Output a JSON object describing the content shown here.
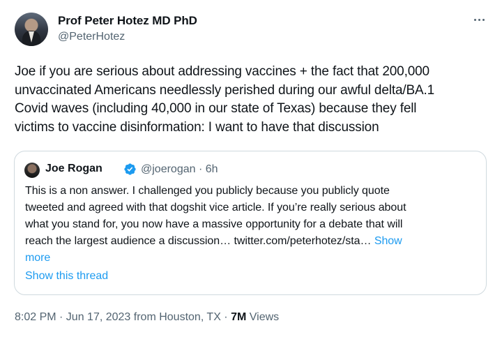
{
  "author": {
    "name": "Prof Peter Hotez MD PhD",
    "handle": "@PeterHotez"
  },
  "tweet": {
    "lines": [
      "Joe if you are serious about addressing vaccines + the fact that 200,000",
      "unvaccinated Americans needlessly perished during our awful delta/BA.1",
      "Covid waves (including 40,000 in our state of Texas) because they fell",
      "victims to vaccine disinformation: I want to have that discussion"
    ]
  },
  "quote": {
    "name": "Joe Rogan",
    "handle_time": "@joerogan · 6h",
    "lines": [
      "This is a non answer.  I challenged you publicly because you publicly quote",
      "tweeted and agreed with that dogshit vice article.  If you’re really serious about",
      "what you stand for, you now have a massive opportunity for a debate that will",
      "reach the largest audience a discussion… twitter.com/peterhotez/sta…"
    ],
    "show_more_1": "Show",
    "show_more_2": "more",
    "show_thread": "Show this thread"
  },
  "meta": {
    "time_date_location": "8:02 PM · Jun 17, 2023 from Houston, TX · ",
    "views_count": "7M",
    "views_label": " Views"
  },
  "icons": {
    "more": "more-horizontal-icon",
    "verified": "verified-badge-icon"
  },
  "colors": {
    "link": "#1d9bf0",
    "secondary_text": "#536471",
    "primary_text": "#0f1419",
    "border": "#cfd9de"
  }
}
